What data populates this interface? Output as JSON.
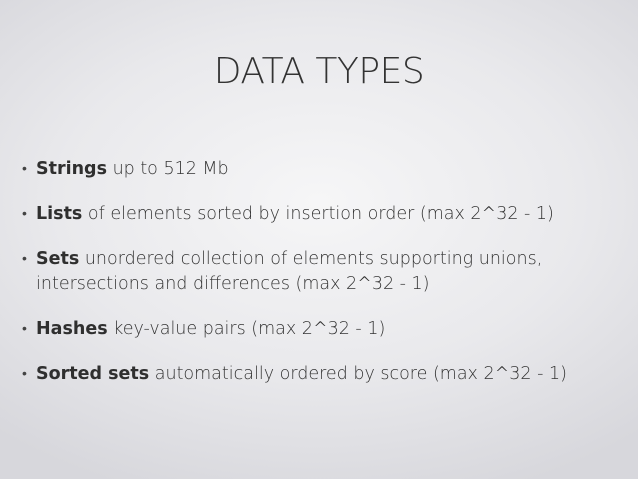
{
  "slide": {
    "title": "DATA TYPES",
    "bullet_symbol": "•",
    "bullets": [
      {
        "term": "Strings",
        "text": " up to 512 Mb"
      },
      {
        "term": "Lists",
        "text": " of elements sorted by insertion order (max 2^32 - 1)"
      },
      {
        "term": "Sets",
        "text": " unordered collection of elements supporting unions, intersections and differences (max 2^32 - 1)"
      },
      {
        "term": "Hashes",
        "text": " key-value pairs (max 2^32 - 1)"
      },
      {
        "term": "Sorted sets",
        "text": " automatically ordered by score (max 2^32 - 1)"
      }
    ]
  }
}
